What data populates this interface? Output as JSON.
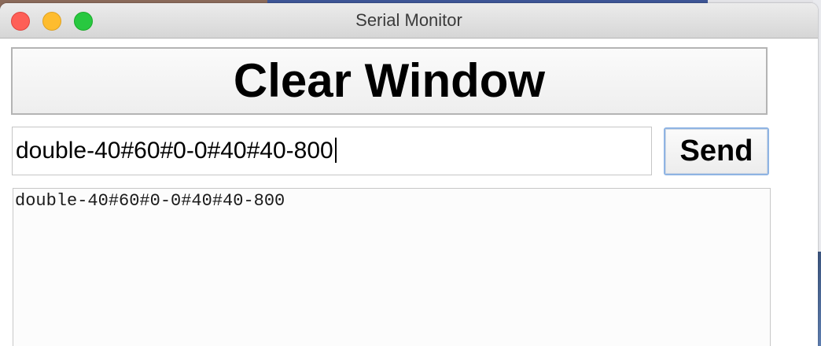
{
  "window": {
    "title": "Serial Monitor",
    "buttons": [
      "close",
      "minimize",
      "zoom"
    ]
  },
  "toolbar": {
    "clear_label": "Clear Window"
  },
  "input": {
    "value": "double-40#60#0-0#40#40-800"
  },
  "send": {
    "label": "Send"
  },
  "output": {
    "lines": [
      "double-40#60#0-0#40#40-800"
    ]
  },
  "colors": {
    "close": "#fe5f57",
    "minimize": "#febc2e",
    "zoom": "#28c840",
    "send_focus_ring": "#8fb4e3"
  }
}
